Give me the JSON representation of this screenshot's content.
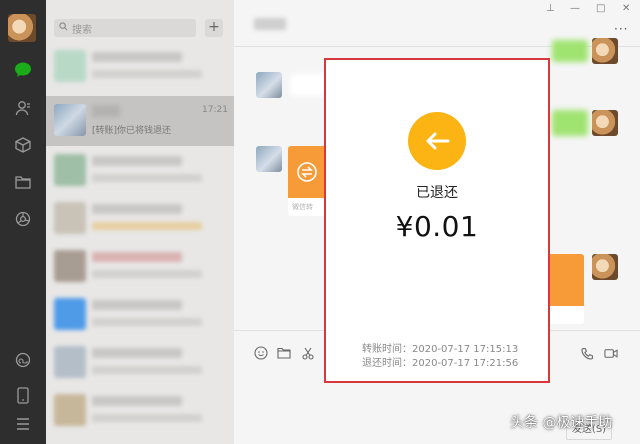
{
  "search": {
    "placeholder": "搜索",
    "add_label": "+"
  },
  "selected_chat": {
    "time": "17:21",
    "preview": "[转账]你已将钱退还"
  },
  "popup": {
    "status": "已退还",
    "amount": "¥0.01",
    "transfer_time_label": "转账时间：",
    "transfer_time": "2020-07-17 17:15:13",
    "refund_time_label": "退还时间：",
    "refund_time": "2020-07-17 17:21:56"
  },
  "chat": {
    "transfer_card_caption": "微信转",
    "send_label": "发送(S)"
  },
  "window_controls": {
    "pin": "⊥",
    "minimize": "—",
    "maximize": "□",
    "close": "✕",
    "more": "···"
  },
  "watermark": "头条 @极速手助",
  "colors": {
    "rail": "#2e2e2e",
    "list_bg": "#e8e7e6",
    "selected_item": "#c5c4c3",
    "popup_border": "#d9363e",
    "refund_icon": "#fbb413",
    "transfer_card": "#f79b39",
    "chat_green": "#9fe370"
  },
  "icons": {
    "rail": [
      "chat-icon",
      "contacts-icon",
      "favorites-icon",
      "files-icon",
      "moments-icon",
      "mini-programs-icon",
      "phone-icon",
      "menu-icon"
    ],
    "input_toolbar": [
      "emoji-icon",
      "folder-icon",
      "scissors-icon",
      "voice-call-icon",
      "video-call-icon"
    ],
    "popup": "back-arrow-icon"
  }
}
